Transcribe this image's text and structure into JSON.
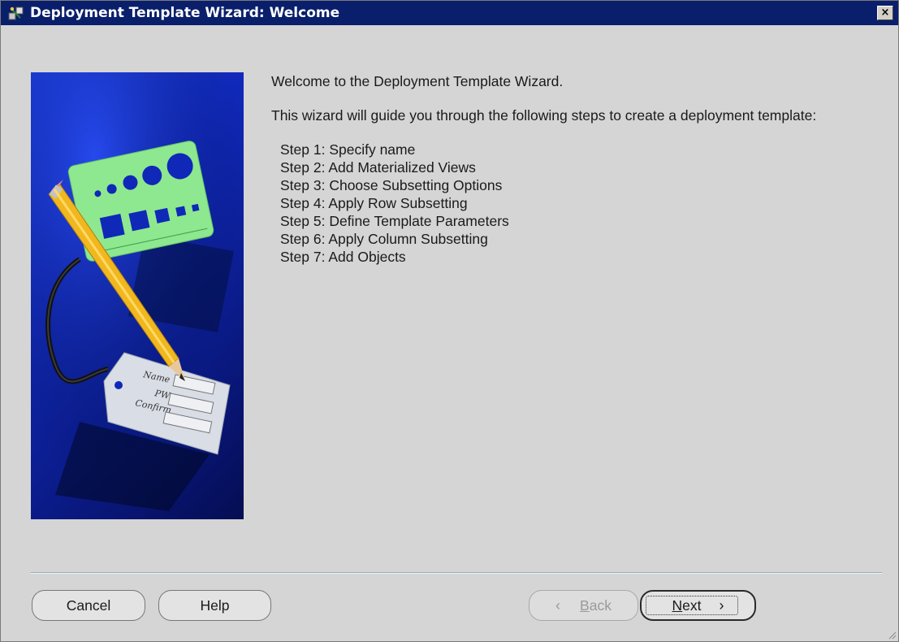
{
  "window": {
    "title": "Deployment Template Wizard: Welcome",
    "close_label": "×"
  },
  "content": {
    "welcome": "Welcome to the Deployment Template Wizard.",
    "intro": "This wizard will guide you through the following steps to create a deployment template:",
    "steps": [
      "Step 1: Specify name",
      "Step 2: Add Materialized Views",
      "Step 3: Choose Subsetting Options",
      "Step 4: Apply Row Subsetting",
      "Step 5: Define Template Parameters",
      "Step 6: Apply Column Subsetting",
      "Step 7: Add Objects"
    ]
  },
  "graphic": {
    "tag_labels": [
      "Name",
      "PW",
      "Confirm"
    ]
  },
  "buttons": {
    "cancel": "Cancel",
    "help": "Help",
    "back_first": "B",
    "back_rest": "ack",
    "back_icon": "‹",
    "next_first": "N",
    "next_rest": "ext",
    "next_icon": "›"
  },
  "colors": {
    "titlebar": "#0a1f6b",
    "dialog_bg": "#d5d5d5",
    "graphic_blue": "#1028b8",
    "divider": "#8fb0b0"
  },
  "icons": {
    "title": "wizard-app-icon",
    "close": "close-icon",
    "back": "chevron-left-icon",
    "next": "chevron-right-icon"
  }
}
